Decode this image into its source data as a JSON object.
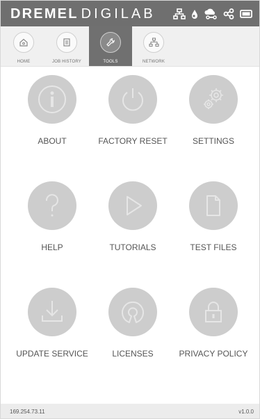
{
  "header": {
    "brand_bold": "DREMEL",
    "brand_light": "DIGILAB",
    "status_icons": [
      "network-icon",
      "drop-icon",
      "cloud-link-icon",
      "share-icon",
      "battery-icon"
    ]
  },
  "tabs": [
    {
      "label": "HOME",
      "icon": "home-icon",
      "active": false
    },
    {
      "label": "JOB HISTORY",
      "icon": "clipboard-icon",
      "active": false
    },
    {
      "label": "TOOLS",
      "icon": "wrench-icon",
      "active": true
    },
    {
      "label": "NETWORK",
      "icon": "network-icon",
      "active": false
    }
  ],
  "tools": [
    {
      "label": "ABOUT",
      "icon": "info-icon"
    },
    {
      "label": "FACTORY RESET",
      "icon": "power-icon"
    },
    {
      "label": "SETTINGS",
      "icon": "gears-icon"
    },
    {
      "label": "HELP",
      "icon": "question-icon"
    },
    {
      "label": "TUTORIALS",
      "icon": "play-icon"
    },
    {
      "label": "TEST FILES",
      "icon": "file-icon"
    },
    {
      "label": "UPDATE SERVICE",
      "icon": "download-icon"
    },
    {
      "label": "LICENSES",
      "icon": "open-source-icon"
    },
    {
      "label": "PRIVACY POLICY",
      "icon": "lock-icon"
    }
  ],
  "footer": {
    "ip": "169.254.73.11",
    "version": "v1.0.0"
  },
  "colors": {
    "header_bg": "#6f6f6f",
    "tab_active_bg": "#707070",
    "tool_disk": "#cdcdcd"
  }
}
